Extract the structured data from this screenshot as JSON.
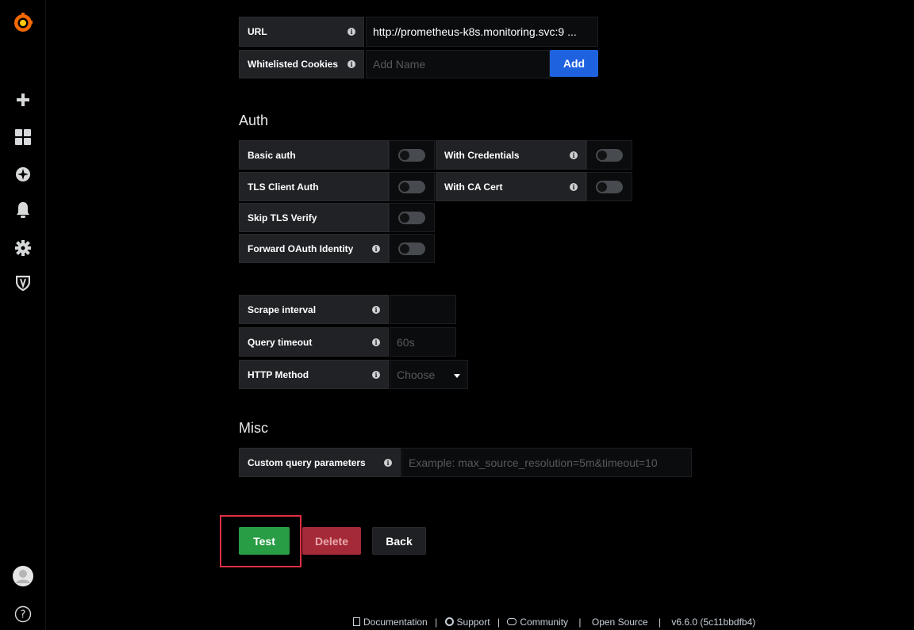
{
  "http": {
    "url_label": "URL",
    "url_value": "http://prometheus-k8s.monitoring.svc:9 ...",
    "cookies_label": "Whitelisted Cookies",
    "cookies_placeholder": "Add Name",
    "add_label": "Add"
  },
  "auth": {
    "title": "Auth",
    "basic_auth": "Basic auth",
    "with_credentials": "With Credentials",
    "tls_client_auth": "TLS Client Auth",
    "with_ca_cert": "With CA Cert",
    "skip_tls_verify": "Skip TLS Verify",
    "forward_oauth": "Forward OAuth Identity"
  },
  "prometheus": {
    "scrape_interval": "Scrape interval",
    "query_timeout": "Query timeout",
    "query_timeout_placeholder": "60s",
    "http_method": "HTTP Method",
    "http_method_value": "Choose"
  },
  "misc": {
    "title": "Misc",
    "custom_query_label": "Custom query parameters",
    "custom_query_placeholder": "Example: max_source_resolution=5m&timeout=10"
  },
  "actions": {
    "test": "Test",
    "delete": "Delete",
    "back": "Back"
  },
  "footer": {
    "documentation": "Documentation",
    "support": "Support",
    "community": "Community",
    "open_source": "Open Source",
    "version": "v6.6.0 (5c11bbdfb4)",
    "separator": "|"
  },
  "colors": {
    "add_button": "#1f62e0",
    "test_button": "#299c46",
    "delete_button": "#a52a37",
    "highlight": "#e02f44"
  }
}
